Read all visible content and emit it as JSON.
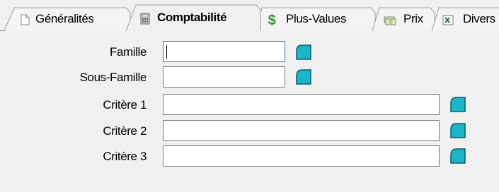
{
  "tabs": [
    {
      "label": "Généralités",
      "icon": "document-icon",
      "active": false
    },
    {
      "label": "Comptabilité",
      "icon": "calculator-icon",
      "active": true
    },
    {
      "label": "Plus-Values",
      "icon": "dollar-icon",
      "active": false
    },
    {
      "label": "Prix",
      "icon": "money-bills-icon",
      "active": false
    },
    {
      "label": "Divers",
      "icon": "excel-icon",
      "active": false
    }
  ],
  "form": {
    "famille": {
      "label": "Famille",
      "value": ""
    },
    "sous_famille": {
      "label": "Sous-Famille",
      "value": ""
    },
    "critere1": {
      "label": "Critère 1",
      "value": ""
    },
    "critere2": {
      "label": "Critère 2",
      "value": ""
    },
    "critere3": {
      "label": "Critère 3",
      "value": ""
    }
  },
  "colors": {
    "picker_fill": "#1ab5c8",
    "picker_border": "#0d5e6a",
    "dollar": "#2e9b2e"
  }
}
